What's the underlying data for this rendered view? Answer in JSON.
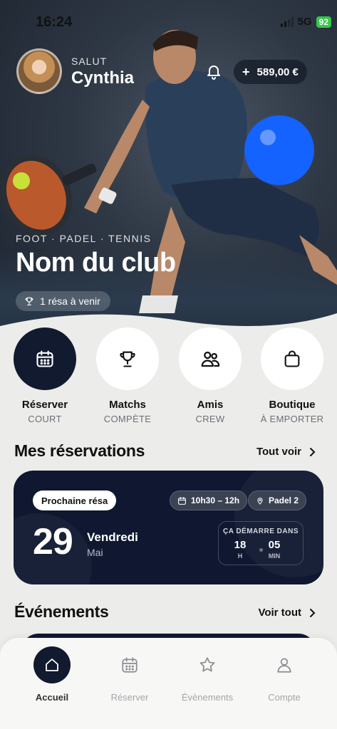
{
  "status": {
    "time": "16:24",
    "network": "5G",
    "battery": "92"
  },
  "header": {
    "greeting": "SALUT",
    "user_name": "Cynthia",
    "balance": "589,00 €"
  },
  "club": {
    "sports": "FOOT · PADEL · TENNIS",
    "name": "Nom du club",
    "upcoming": "1 résa à venir"
  },
  "actions": [
    {
      "label": "Réserver",
      "sub": "COURT",
      "icon": "calendar-icon"
    },
    {
      "label": "Matchs",
      "sub": "COMPÈTE",
      "icon": "trophy-icon"
    },
    {
      "label": "Amis",
      "sub": "CREW",
      "icon": "friends-icon"
    },
    {
      "label": "Boutique",
      "sub": "À EMPORTER",
      "icon": "bag-icon"
    }
  ],
  "reservations": {
    "title": "Mes réservations",
    "link": "Tout voir",
    "next_label": "Prochaine résa",
    "time": "10h30 – 12h",
    "court": "Padel 2",
    "day": "29",
    "weekday": "Vendredi",
    "month": "Mai",
    "countdown_title": "ÇA DÉMARRE DANS",
    "hours": "18",
    "hours_unit": "H",
    "minutes": "05",
    "minutes_unit": "MIN"
  },
  "events": {
    "title": "Événements",
    "link": "Voir tout"
  },
  "tabs": [
    {
      "label": "Accueil",
      "icon": "home-icon",
      "active": true
    },
    {
      "label": "Réserver",
      "icon": "calendar-icon"
    },
    {
      "label": "Évènements",
      "icon": "star-icon"
    },
    {
      "label": "Compte",
      "icon": "user-icon"
    }
  ],
  "colors": {
    "accent": "#1463ff",
    "dark": "#0f1830",
    "background": "#ecedea"
  }
}
